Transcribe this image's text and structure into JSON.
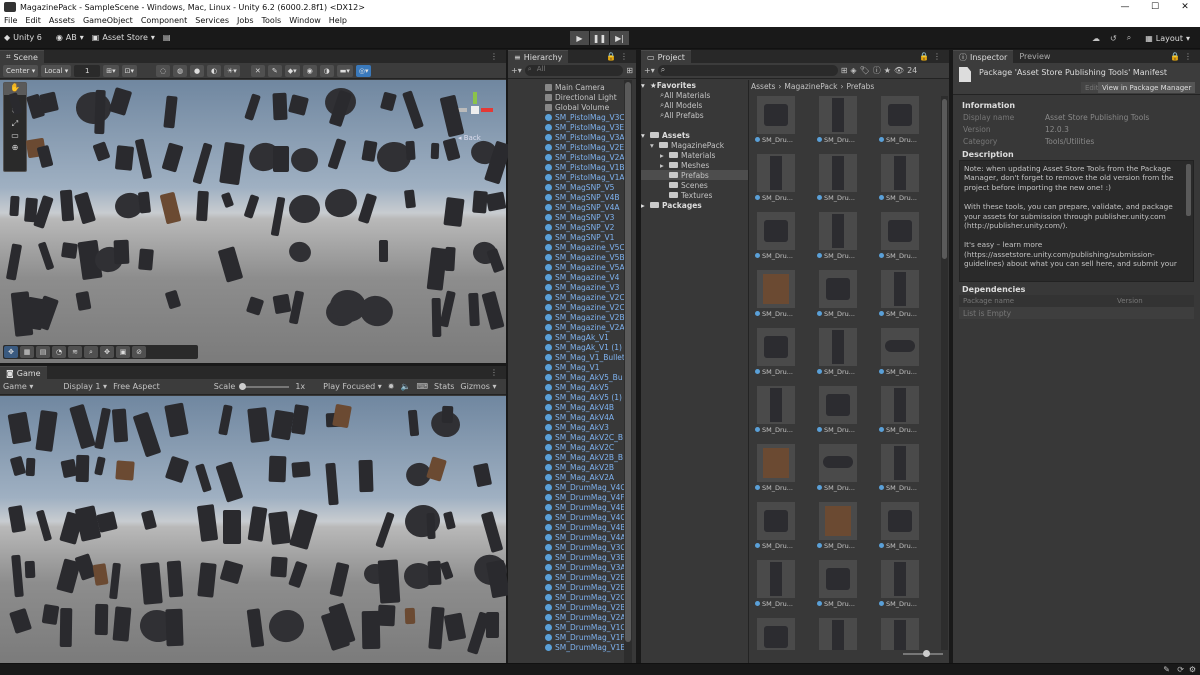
{
  "window": {
    "title": "MagazinePack - SampleScene - Windows, Mac, Linux - Unity 6.2 (6000.2.8f1) <DX12>",
    "controls": [
      "—",
      "☐",
      "✕"
    ]
  },
  "menu": [
    "File",
    "Edit",
    "Assets",
    "GameObject",
    "Component",
    "Services",
    "Jobs",
    "Tools",
    "Window",
    "Help"
  ],
  "toolbar": {
    "unity": "Unity 6",
    "account": "AB",
    "asset_store": "Asset Store",
    "layout": "Layout"
  },
  "scene": {
    "tab": "Scene",
    "pivot": "Center",
    "space": "Local",
    "grid": "1",
    "back_label": "Back",
    "persp_label": "Persp"
  },
  "game": {
    "tab": "Game",
    "mode": "Game",
    "display": "Display 1",
    "aspect": "Free Aspect",
    "scale_label": "Scale",
    "scale_value": "1x",
    "play_focused": "Play Focused",
    "stats": "Stats",
    "gizmos": "Gizmos"
  },
  "hierarchy": {
    "tab": "Hierarchy",
    "search_placeholder": "All",
    "items": [
      "Main Camera",
      "Directional Light",
      "Global Volume",
      "SM_PistolMag_V3C",
      "SM_PistolMag_V3E",
      "SM_PistolMag_V3A",
      "SM_PistolMag_V2E",
      "SM_PistolMag_V2A",
      "SM_PistolMag_V1B",
      "SM_PistolMag_V1A",
      "SM_MagSNP_V5",
      "SM_MagSNP_V4B",
      "SM_MagSNP_V4A",
      "SM_MagSNP_V3",
      "SM_MagSNP_V2",
      "SM_MagSNP_V1",
      "SM_Magazine_V5C",
      "SM_Magazine_V5B",
      "SM_Magazine_V5A",
      "SM_Magazine_V4",
      "SM_Magazine_V3",
      "SM_Magazine_V2C",
      "SM_Magazine_V2C",
      "SM_Magazine_V2B",
      "SM_Magazine_V2A",
      "SM_MagAk_V1",
      "SM_MagAk_V1 (1)",
      "SM_Mag_V1_Bullet",
      "SM_Mag_V1",
      "SM_Mag_AkV5_Bu",
      "SM_Mag_AkV5",
      "SM_Mag_AkV5 (1)",
      "SM_Mag_AkV4B",
      "SM_Mag_AkV4A",
      "SM_Mag_AkV3",
      "SM_Mag_AkV2C_B",
      "SM_Mag_AkV2C",
      "SM_Mag_AkV2B_B",
      "SM_Mag_AkV2B",
      "SM_Mag_AkV2A",
      "SM_DrumMag_V4C",
      "SM_DrumMag_V4F",
      "SM_DrumMag_V4E",
      "SM_DrumMag_V4C",
      "SM_DrumMag_V4B",
      "SM_DrumMag_V4A",
      "SM_DrumMag_V3C",
      "SM_DrumMag_V3E",
      "SM_DrumMag_V3A",
      "SM_DrumMag_V2E",
      "SM_DrumMag_V2E",
      "SM_DrumMag_V2C",
      "SM_DrumMag_V2B",
      "SM_DrumMag_V2A",
      "SM_DrumMag_V1C",
      "SM_DrumMag_V1F",
      "SM_DrumMag_V1E"
    ]
  },
  "project": {
    "tab": "Project",
    "visible_count": "24",
    "favorites": {
      "label": "Favorites",
      "items": [
        "All Materials",
        "All Models",
        "All Prefabs"
      ]
    },
    "assets": {
      "label": "Assets",
      "pack": "MagazinePack",
      "folders": [
        "Materials",
        "Meshes",
        "Prefabs",
        "Scenes",
        "Textures"
      ]
    },
    "packages": "Packages",
    "breadcrumb": [
      "Assets",
      "MagazinePack",
      "Prefabs"
    ],
    "thumb_label": "SM_Dru..."
  },
  "inspector": {
    "tab": "Inspector",
    "preview_tab": "Preview",
    "title": "Package 'Asset Store Publishing Tools' Manifest",
    "edit": "Edit",
    "view_pm": "View in Package Manager",
    "info_header": "Information",
    "fields": [
      {
        "label": "Display name",
        "value": "Asset Store Publishing Tools"
      },
      {
        "label": "Version",
        "value": "12.0.3"
      },
      {
        "label": "Category",
        "value": "Tools/Utilities"
      }
    ],
    "desc_header": "Description",
    "description": [
      "Note: when updating Asset Store Tools from the Package Manager, don't forget to remove the old version from the project before importing the new one! :)",
      "With these tools, you can prepare, validate, and package your assets for submission through publisher.unity.com (http://publisher.unity.com/).",
      "It's easy – learn more (https://assetstore.unity.com/publishing/submission-guidelines) about what you can sell here, and submit your"
    ],
    "dep_header": "Dependencies",
    "dep_cols": [
      "Package name",
      "Version"
    ],
    "dep_empty": "List is Empty"
  },
  "colors": {
    "accent": "#3a79bb",
    "panel": "#383838",
    "selected_text": "#7fb3f0",
    "folder": "#c9c9c9"
  }
}
